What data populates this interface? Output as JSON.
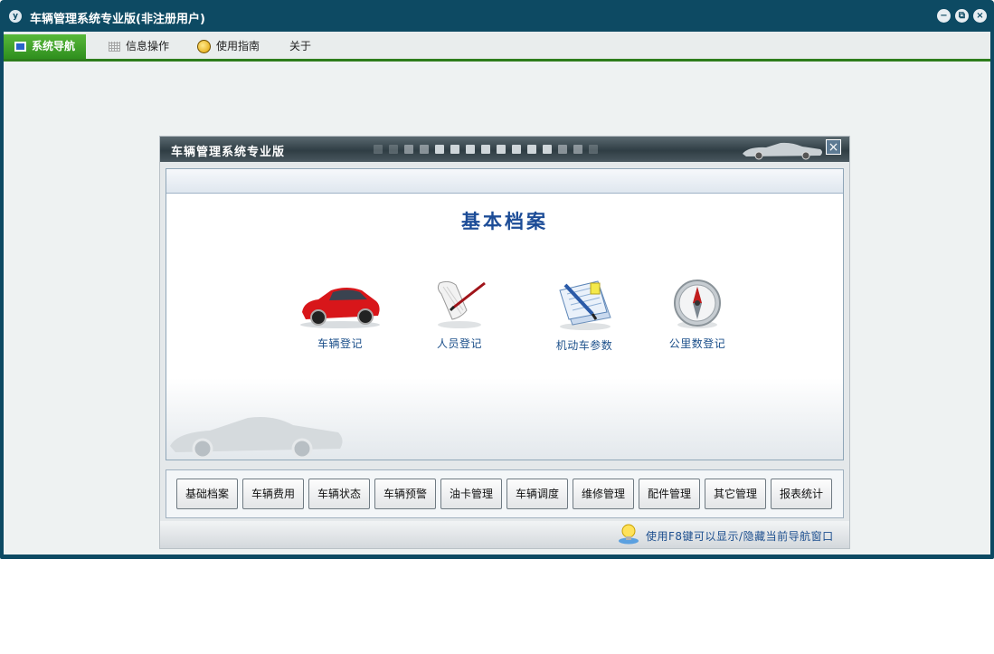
{
  "window": {
    "title": "车辆管理系统专业版(非注册用户)",
    "app_icon_glyph": "y",
    "buttons": {
      "minimize": "−",
      "restore": "⧉",
      "close": "×"
    }
  },
  "menubar": {
    "items": [
      {
        "label": "系统导航",
        "icon": "monitor-icon",
        "active": true
      },
      {
        "label": "信息操作",
        "icon": "grid-icon",
        "active": false
      },
      {
        "label": "使用指南",
        "icon": "guide-icon",
        "active": false
      },
      {
        "label": "关于",
        "icon": null,
        "active": false
      }
    ]
  },
  "panel": {
    "title": "车辆管理系统专业版",
    "close_glyph": "×",
    "section_heading": "基本档案",
    "icons": [
      {
        "label": "车辆登记",
        "icon": "red-car-icon"
      },
      {
        "label": "人员登记",
        "icon": "scroll-pen-icon"
      },
      {
        "label": "机动车参数",
        "icon": "document-pen-icon"
      },
      {
        "label": "公里数登记",
        "icon": "compass-icon"
      }
    ],
    "tabs": [
      "基础档案",
      "车辆费用",
      "车辆状态",
      "车辆预警",
      "油卡管理",
      "车辆调度",
      "维修管理",
      "配件管理",
      "其它管理",
      "报表统计"
    ],
    "status_tip": "使用F8键可以显示/隐藏当前导航窗口"
  },
  "colors": {
    "title_bar": "#0d4a63",
    "menu_active": "#3f9f28",
    "heading": "#1c4c97",
    "label": "#1b4f8a"
  }
}
